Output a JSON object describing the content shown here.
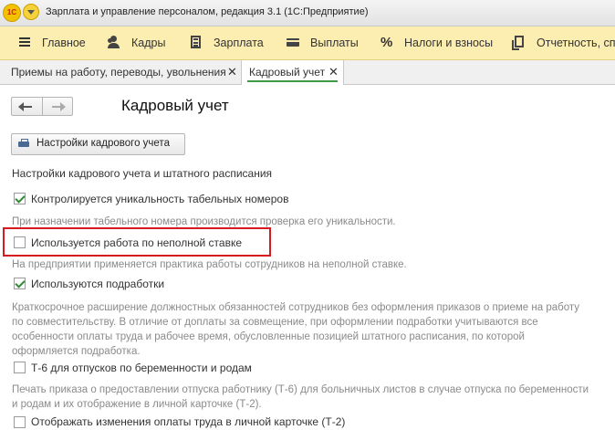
{
  "window": {
    "logo_text": "1С",
    "title": "Зарплата и управление персоналом, редакция 3.1  (1С:Предприятие)"
  },
  "sections": [
    {
      "label": "Главное",
      "icon": "menu-bars-icon"
    },
    {
      "label": "Кадры",
      "icon": "people-icon"
    },
    {
      "label": "Зарплата",
      "icon": "calculator-icon"
    },
    {
      "label": "Выплаты",
      "icon": "wallet-icon"
    },
    {
      "label": "Налоги и взносы",
      "icon": "percent-icon"
    },
    {
      "label": "Отчетность, спр",
      "icon": "documents-icon"
    }
  ],
  "tabs": [
    {
      "label": "Приемы на работу, переводы, увольнения",
      "close": "✕",
      "active": false
    },
    {
      "label": "Кадровый учет",
      "close": "✕",
      "active": true
    }
  ],
  "page": {
    "title": "Кадровый учет",
    "settings_button": "Настройки кадрового учета",
    "section_heading": "Настройки кадрового учета и штатного расписания"
  },
  "options": [
    {
      "label": "Контролируется уникальность табельных номеров",
      "checked": true,
      "hint": "При назначении табельного номера производится проверка его уникальности."
    },
    {
      "label": "Используется работа по неполной ставке",
      "checked": false,
      "highlighted": true,
      "hint": "На предприятии применяется практика работы сотрудников на неполной ставке."
    },
    {
      "label": "Используются подработки",
      "checked": true,
      "hint_lines": [
        "Краткосрочное расширение должностных обязанностей сотрудников без оформления приказов о приеме на работу",
        "по совместительству. В отличие от доплаты за совмещение, при оформлении подработки учитываются все",
        "особенности оплаты труда и рабочее время, обусловленные позицией штатного расписания, по которой",
        "оформляется подработка."
      ]
    },
    {
      "label": "Т-6 для отпусков по беременности и родам",
      "checked": false,
      "hint_lines": [
        "Печать приказа о предоставлении отпуска работнику (Т-6) для больничных листов в случае отпуска по беременности",
        "и родам и их отображение в личной карточке (Т-2)."
      ]
    },
    {
      "label": "Отображать изменения оплаты труда в личной карточке (Т-2)",
      "checked": false
    }
  ],
  "colors": {
    "section_bar": "#fcedb0",
    "active_tab_underline": "#3d9a42",
    "checkmark": "#2f8a34",
    "highlight_border": "#d71920",
    "hint_text": "#8a8a8a"
  }
}
